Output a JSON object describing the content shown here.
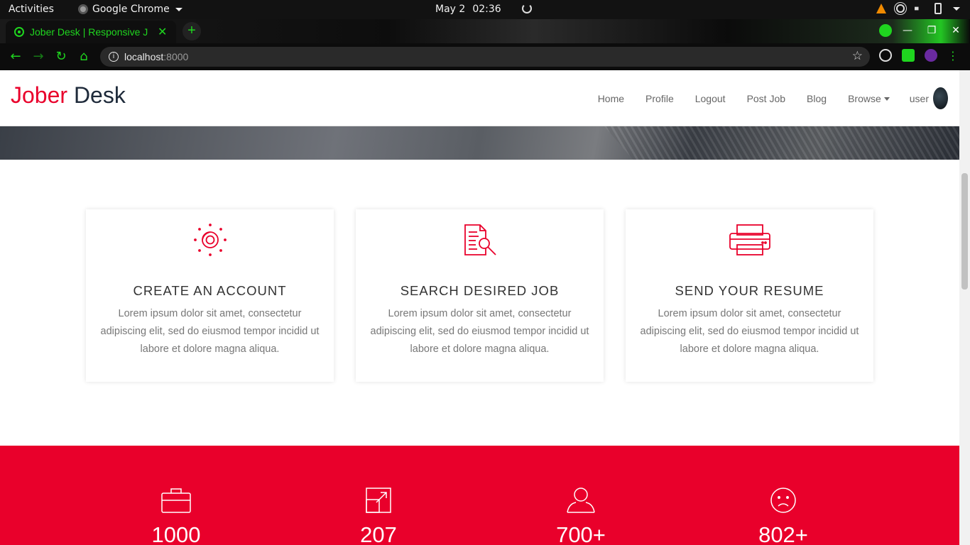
{
  "os_bar": {
    "activities": "Activities",
    "app_name": "Google Chrome",
    "date": "May 2",
    "time": "02:36"
  },
  "browser": {
    "tab_title": "Jober Desk | Responsive J",
    "tab_close": "✕",
    "new_tab": "+",
    "url_host": "localhost",
    "url_port": ":8000",
    "window_minimize": "—",
    "window_maximize": "❐",
    "window_close": "✕"
  },
  "site": {
    "logo_part1": "Jober",
    "logo_part2": " Desk",
    "nav": {
      "home": "Home",
      "profile": "Profile",
      "logout": "Logout",
      "post_job": "Post Job",
      "blog": "Blog",
      "browse": "Browse",
      "user": "user"
    }
  },
  "features": [
    {
      "title": "CREATE AN ACCOUNT",
      "text": "Lorem ipsum dolor sit amet, consectetur adipiscing elit, sed do eiusmod tempor incidid ut labore et dolore magna aliqua.",
      "icon": "account-target-icon"
    },
    {
      "title": "SEARCH DESIRED JOB",
      "text": "Lorem ipsum dolor sit amet, consectetur adipiscing elit, sed do eiusmod tempor incidid ut labore et dolore magna aliqua.",
      "icon": "document-search-icon"
    },
    {
      "title": "SEND YOUR RESUME",
      "text": "Lorem ipsum dolor sit amet, consectetur adipiscing elit, sed do eiusmod tempor incidid ut labore et dolore magna aliqua.",
      "icon": "printer-icon"
    }
  ],
  "stats": [
    {
      "value": "1000",
      "icon": "briefcase-icon"
    },
    {
      "value": "207",
      "icon": "expand-arrow-icon"
    },
    {
      "value": "700+",
      "icon": "user-icon"
    },
    {
      "value": "802+",
      "icon": "sad-face-icon"
    }
  ],
  "colors": {
    "brand_red": "#e9002b",
    "logo_dark": "#1e2a3a",
    "browser_accent": "#1fd51f"
  }
}
